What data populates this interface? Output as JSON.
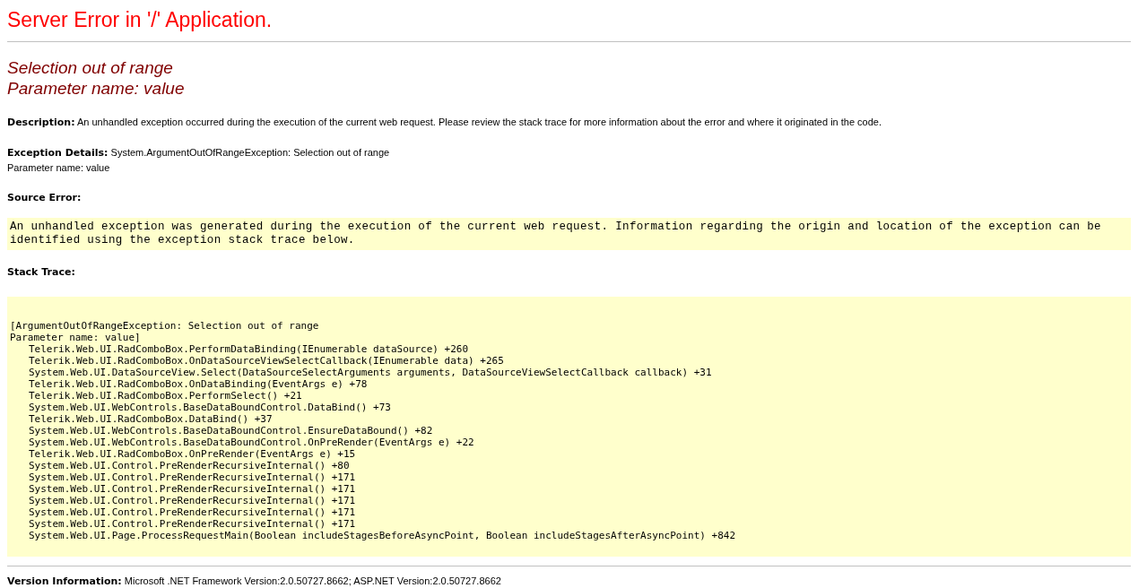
{
  "title": "Server Error in '/' Application.",
  "error_heading": [
    "Selection out of range",
    "Parameter name: value"
  ],
  "description": "**Description:** An unhandled exception occurred during the execution of the current web request. Please review the stack trace for more information about the error and where it originated in the code.",
  "exception_details": [
    "**Exception Details:** System.ArgumentOutOfRangeException: Selection out of range",
    "Parameter name: value"
  ],
  "source_error": {
    "label": "Source Error:",
    "text": "An unhandled exception was generated during the execution of the current web request. Information regarding the origin and location of the exception can be identified using the exception stack trace below."
  },
  "stack_trace": {
    "label": "Stack Trace:",
    "header": [
      "[ArgumentOutOfRangeException: Selection out of range",
      "Parameter name: value]"
    ],
    "frames": [
      "Telerik.Web.UI.RadComboBox.PerformDataBinding(IEnumerable dataSource) +260",
      "Telerik.Web.UI.RadComboBox.OnDataSourceViewSelectCallback(IEnumerable data) +265",
      "System.Web.UI.DataSourceView.Select(DataSourceSelectArguments arguments, DataSourceViewSelectCallback callback) +31",
      "Telerik.Web.UI.RadComboBox.OnDataBinding(EventArgs e) +78",
      "Telerik.Web.UI.RadComboBox.PerformSelect() +21",
      "System.Web.UI.WebControls.BaseDataBoundControl.DataBind() +73",
      "Telerik.Web.UI.RadComboBox.DataBind() +37",
      "System.Web.UI.WebControls.BaseDataBoundControl.EnsureDataBound() +82",
      "System.Web.UI.WebControls.BaseDataBoundControl.OnPreRender(EventArgs e) +22",
      "Telerik.Web.UI.RadComboBox.OnPreRender(EventArgs e) +15",
      "System.Web.UI.Control.PreRenderRecursiveInternal() +80",
      "System.Web.UI.Control.PreRenderRecursiveInternal() +171",
      "System.Web.UI.Control.PreRenderRecursiveInternal() +171",
      "System.Web.UI.Control.PreRenderRecursiveInternal() +171",
      "System.Web.UI.Control.PreRenderRecursiveInternal() +171",
      "System.Web.UI.Control.PreRenderRecursiveInternal() +171",
      "System.Web.UI.Page.ProcessRequestMain(Boolean includeStagesBeforeAsyncPoint, Boolean includeStagesAfterAsyncPoint) +842"
    ]
  },
  "version_info": "**Version Information:** Microsoft .NET Framework Version:2.0.50727.8662; ASP.NET Version:2.0.50727.8662"
}
